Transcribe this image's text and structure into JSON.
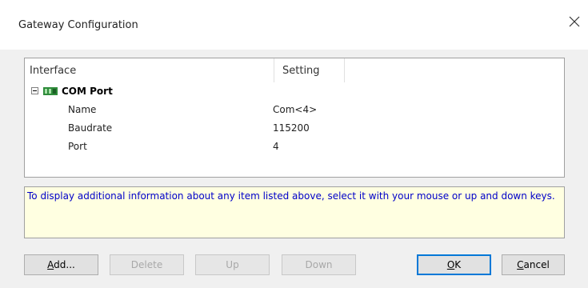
{
  "window": {
    "title": "Gateway Configuration",
    "close_glyph": "×"
  },
  "tree": {
    "columns": [
      "Interface",
      "Setting"
    ],
    "node": {
      "label": "COM Port",
      "icon": "com-port-icon",
      "expanded": true,
      "properties": [
        {
          "name": "Name",
          "value": "Com<4>"
        },
        {
          "name": "Baudrate",
          "value": "115200"
        },
        {
          "name": "Port",
          "value": "4"
        }
      ]
    }
  },
  "info": {
    "text": "To display additional information about any item listed above, select it with your mouse or up and down keys."
  },
  "buttons": {
    "add": {
      "mnemonic": "A",
      "rest": "dd...",
      "enabled": true
    },
    "delete": {
      "mnemonic": "",
      "label": "Delete",
      "enabled": false
    },
    "up": {
      "mnemonic": "",
      "label": "Up",
      "enabled": false
    },
    "down": {
      "mnemonic": "",
      "label": "Down",
      "enabled": false
    },
    "ok": {
      "mnemonic": "O",
      "rest": "K",
      "enabled": true
    },
    "cancel": {
      "mnemonic": "C",
      "rest": "ancel",
      "enabled": true
    }
  },
  "colors": {
    "info_bg": "#ffffe1",
    "info_text": "#0000c8",
    "default_button_border": "#0078d7"
  }
}
